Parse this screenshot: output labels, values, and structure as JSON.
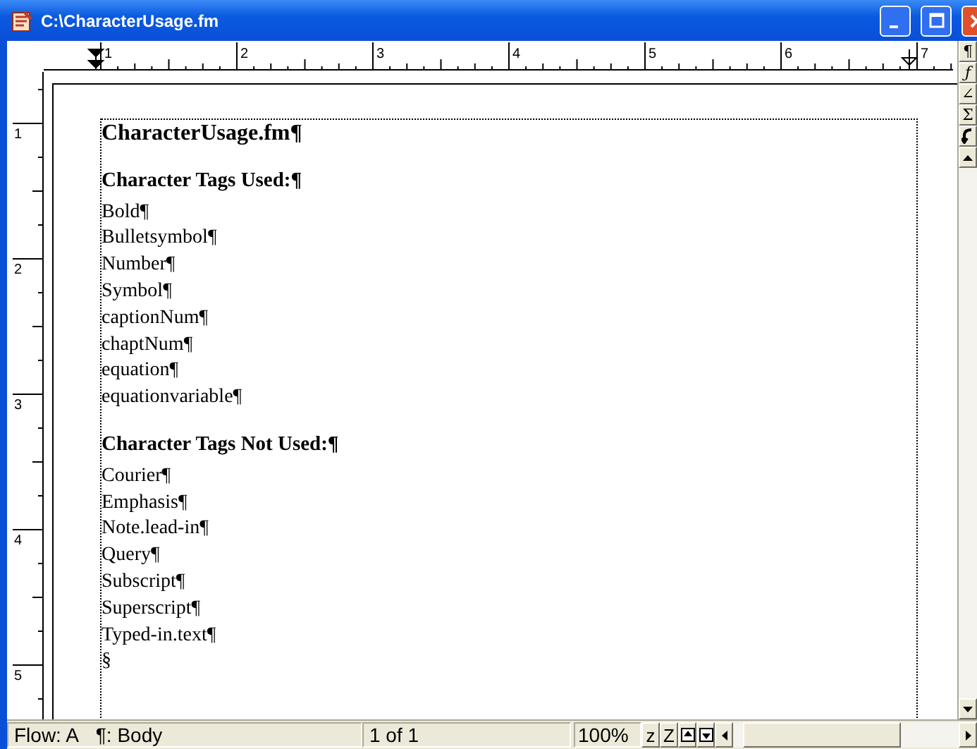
{
  "window": {
    "title": "C:\\CharacterUsage.fm"
  },
  "horizontal_ruler": {
    "labels": [
      "1",
      "2",
      "3",
      "4",
      "5",
      "6",
      "7"
    ]
  },
  "vertical_ruler": {
    "labels": [
      "1",
      "2",
      "3",
      "4",
      "5"
    ]
  },
  "side_toolbar": {
    "buttons": [
      "¶",
      "ƒ",
      "∠",
      "Σ"
    ]
  },
  "document": {
    "paragraphs": [
      {
        "kind": "title",
        "text": "CharacterUsage.fm¶"
      },
      {
        "kind": "heading",
        "text": "Character Tags Used:¶"
      },
      {
        "kind": "body",
        "text": "Bold¶"
      },
      {
        "kind": "body",
        "text": "Bulletsymbol¶"
      },
      {
        "kind": "body",
        "text": "Number¶"
      },
      {
        "kind": "body",
        "text": "Symbol¶"
      },
      {
        "kind": "body",
        "text": "captionNum¶"
      },
      {
        "kind": "body",
        "text": "chaptNum¶"
      },
      {
        "kind": "body",
        "text": "equation¶"
      },
      {
        "kind": "body",
        "text": "equationvariable¶"
      },
      {
        "kind": "heading",
        "text": "Character Tags Not Used:¶"
      },
      {
        "kind": "body",
        "text": "Courier¶"
      },
      {
        "kind": "body",
        "text": "Emphasis¶"
      },
      {
        "kind": "body",
        "text": "Note.lead-in¶"
      },
      {
        "kind": "body",
        "text": "Query¶"
      },
      {
        "kind": "body",
        "text": "Subscript¶"
      },
      {
        "kind": "body",
        "text": "Superscript¶"
      },
      {
        "kind": "body",
        "text": "Typed-in.text¶"
      },
      {
        "kind": "body",
        "text": "§"
      }
    ]
  },
  "status_bar": {
    "flow": "Flow: A",
    "paragraph_tag": "¶: Body",
    "page": "1 of 1",
    "zoom": "100%",
    "zoom_buttons": [
      "z",
      "Z"
    ]
  }
}
